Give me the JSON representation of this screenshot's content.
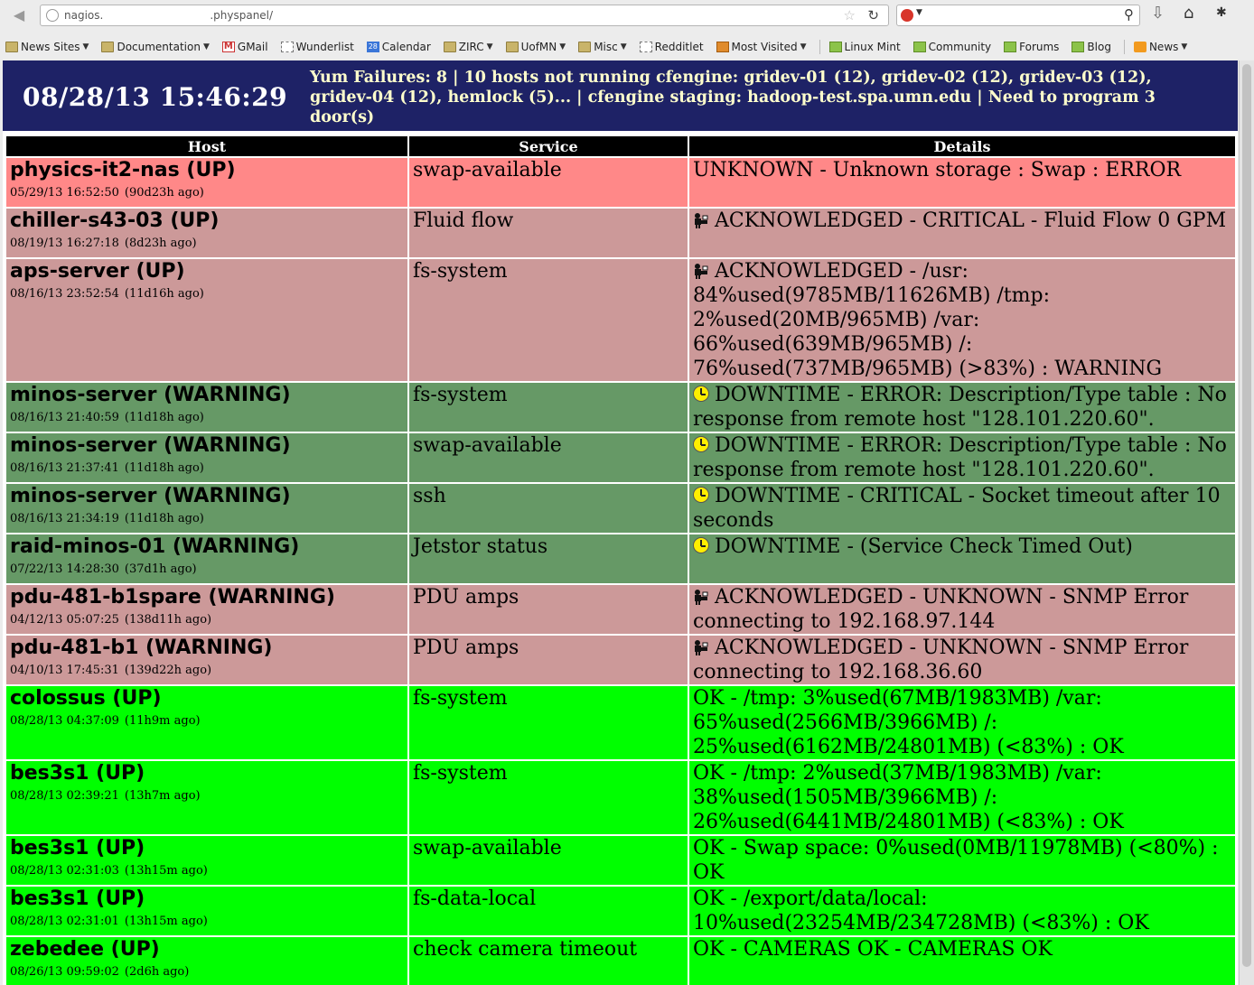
{
  "browser": {
    "url_prefix": "nagios.",
    "url_suffix": ".physpanel/",
    "bookmarks": [
      {
        "label": "News Sites",
        "icon": "folder-icon",
        "dropdown": true
      },
      {
        "label": "Documentation",
        "icon": "folder-icon",
        "dropdown": true
      },
      {
        "label": "GMail",
        "icon": "gmail-icon",
        "dropdown": false
      },
      {
        "label": "Wunderlist",
        "icon": "page-icon",
        "dropdown": false
      },
      {
        "label": "Calendar",
        "icon": "calendar-icon",
        "dropdown": false
      },
      {
        "label": "ZIRC",
        "icon": "folder-icon",
        "dropdown": true
      },
      {
        "label": "UofMN",
        "icon": "folder-icon",
        "dropdown": true
      },
      {
        "label": "Misc",
        "icon": "folder-icon",
        "dropdown": true
      },
      {
        "label": "Redditlet",
        "icon": "page-icon",
        "dropdown": false
      },
      {
        "label": "Most Visited",
        "icon": "most-visited-icon",
        "dropdown": true
      },
      {
        "label": "Linux Mint",
        "icon": "mint-icon",
        "dropdown": false
      },
      {
        "label": "Community",
        "icon": "mint-icon",
        "dropdown": false
      },
      {
        "label": "Forums",
        "icon": "mint-icon",
        "dropdown": false
      },
      {
        "label": "Blog",
        "icon": "mint-icon",
        "dropdown": false
      },
      {
        "label": "News",
        "icon": "rss-icon",
        "dropdown": true
      }
    ],
    "calendar_icon_text": "28"
  },
  "panel": {
    "datetime": "08/28/13 15:46:29",
    "alerts": "Yum Failures: 8 | 10 hosts not running cfengine: gridev-01 (12), gridev-02 (12), gridev-03 (12), gridev-04 (12), hemlock (5)... | cfengine staging: hadoop-test.spa.umn.edu | Need to program 3 door(s)"
  },
  "table": {
    "headers": {
      "host": "Host",
      "service": "Service",
      "details": "Details"
    },
    "colors": {
      "unknown": "#ff8888",
      "acknowledged": "#cc9999",
      "downtime": "#669966",
      "ok": "#00ff00",
      "header_bg": "#1e2266"
    },
    "rows": [
      {
        "host": "physics-it2-nas (UP)",
        "time": "05/29/13 16:52:50",
        "ago": "(90d23h ago)",
        "service": "swap-available",
        "icon": "",
        "details": "UNKNOWN - Unknown storage : Swap : ERROR",
        "severity": "unknown"
      },
      {
        "host": "chiller-s43-03 (UP)",
        "time": "08/19/13 16:27:18",
        "ago": "(8d23h ago)",
        "service": "Fluid flow",
        "icon": "acknowledged-icon",
        "details": "ACKNOWLEDGED - CRITICAL - Fluid Flow 0 GPM",
        "severity": "ack"
      },
      {
        "host": "aps-server (UP)",
        "time": "08/16/13 23:52:54",
        "ago": "(11d16h ago)",
        "service": "fs-system",
        "icon": "acknowledged-icon",
        "details": "ACKNOWLEDGED - /usr: 84%used(9785MB/11626MB) /tmp: 2%used(20MB/965MB) /var: 66%used(639MB/965MB) /: 76%used(737MB/965MB) (>83%) : WARNING",
        "severity": "ack"
      },
      {
        "host": "minos-server (WARNING)",
        "time": "08/16/13 21:40:59",
        "ago": "(11d18h ago)",
        "service": "fs-system",
        "icon": "downtime-clock-icon",
        "details": "DOWNTIME - ERROR: Description/Type table : No response from remote host \"128.101.220.60\".",
        "severity": "down"
      },
      {
        "host": "minos-server (WARNING)",
        "time": "08/16/13 21:37:41",
        "ago": "(11d18h ago)",
        "service": "swap-available",
        "icon": "downtime-clock-icon",
        "details": "DOWNTIME - ERROR: Description/Type table : No response from remote host \"128.101.220.60\".",
        "severity": "down"
      },
      {
        "host": "minos-server (WARNING)",
        "time": "08/16/13 21:34:19",
        "ago": "(11d18h ago)",
        "service": "ssh",
        "icon": "downtime-clock-icon",
        "details": "DOWNTIME - CRITICAL - Socket timeout after 10 seconds",
        "severity": "down"
      },
      {
        "host": "raid-minos-01 (WARNING)",
        "time": "07/22/13 14:28:30",
        "ago": "(37d1h ago)",
        "service": "Jetstor status",
        "icon": "downtime-clock-icon",
        "details": "DOWNTIME - (Service Check Timed Out)",
        "severity": "down"
      },
      {
        "host": "pdu-481-b1spare (WARNING)",
        "time": "04/12/13 05:07:25",
        "ago": "(138d11h ago)",
        "service": "PDU amps",
        "icon": "acknowledged-icon",
        "details": "ACKNOWLEDGED - UNKNOWN - SNMP Error connecting to 192.168.97.144",
        "severity": "ack"
      },
      {
        "host": "pdu-481-b1 (WARNING)",
        "time": "04/10/13 17:45:31",
        "ago": "(139d22h ago)",
        "service": "PDU amps",
        "icon": "acknowledged-icon",
        "details": "ACKNOWLEDGED - UNKNOWN - SNMP Error connecting to 192.168.36.60",
        "severity": "ack"
      },
      {
        "host": "colossus (UP)",
        "time": "08/28/13 04:37:09",
        "ago": "(11h9m ago)",
        "service": "fs-system",
        "icon": "",
        "details": "OK - /tmp: 3%used(67MB/1983MB) /var: 65%used(2566MB/3966MB) /: 25%used(6162MB/24801MB) (<83%) : OK",
        "severity": "ok"
      },
      {
        "host": "bes3s1 (UP)",
        "time": "08/28/13 02:39:21",
        "ago": "(13h7m ago)",
        "service": "fs-system",
        "icon": "",
        "details": "OK - /tmp: 2%used(37MB/1983MB) /var: 38%used(1505MB/3966MB) /: 26%used(6441MB/24801MB) (<83%) : OK",
        "severity": "ok"
      },
      {
        "host": "bes3s1 (UP)",
        "time": "08/28/13 02:31:03",
        "ago": "(13h15m ago)",
        "service": "swap-available",
        "icon": "",
        "details": "OK - Swap space: 0%used(0MB/11978MB) (<80%) : OK",
        "severity": "ok"
      },
      {
        "host": "bes3s1 (UP)",
        "time": "08/28/13 02:31:01",
        "ago": "(13h15m ago)",
        "service": "fs-data-local",
        "icon": "",
        "details": "OK - /export/data/local: 10%used(23254MB/234728MB) (<83%) : OK",
        "severity": "ok"
      },
      {
        "host": "zebedee (UP)",
        "time": "08/26/13 09:59:02",
        "ago": "(2d6h ago)",
        "service": "check camera timeout",
        "icon": "",
        "details": "OK - CAMERAS OK - CAMERAS OK",
        "severity": "ok"
      }
    ]
  }
}
